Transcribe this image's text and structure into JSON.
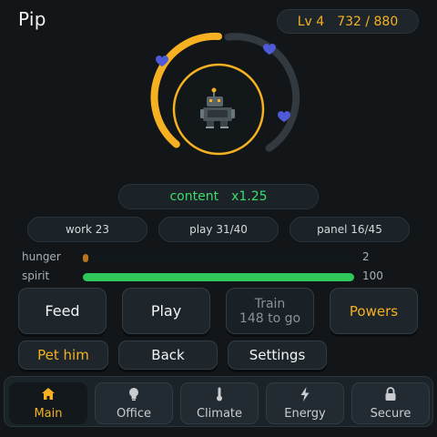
{
  "header": {
    "pet_name": "Pip",
    "level": "Lv 4",
    "xp": "732 / 880"
  },
  "pet": {
    "hearts": 3,
    "ring_progress": 0.5
  },
  "mood": {
    "label": "content",
    "multiplier": "x1.25"
  },
  "stats": [
    {
      "label": "work 23"
    },
    {
      "label": "play 31/40"
    },
    {
      "label": "panel 16/45"
    }
  ],
  "meters": [
    {
      "label": "hunger",
      "value": "2",
      "fraction": 0.02,
      "color": "#b8731b"
    },
    {
      "label": "spirit",
      "value": "100",
      "fraction": 1.0,
      "color": "#2ec95a"
    }
  ],
  "actions": {
    "feed": "Feed",
    "play": "Play",
    "train_title": "Train",
    "train_sub": "148 to go",
    "powers": "Powers",
    "pet_him": "Pet him",
    "back": "Back",
    "settings": "Settings"
  },
  "tabs": [
    {
      "label": "Main",
      "icon": "home-icon",
      "active": true
    },
    {
      "label": "Office",
      "icon": "lightbulb-icon",
      "active": false
    },
    {
      "label": "Climate",
      "icon": "thermometer-icon",
      "active": false
    },
    {
      "label": "Energy",
      "icon": "lightning-icon",
      "active": false
    },
    {
      "label": "Secure",
      "icon": "lock-icon",
      "active": false
    }
  ],
  "colors": {
    "accent": "#f5b121",
    "mood_green": "#3ddc6a",
    "heart": "#4f5ad8",
    "background": "#121619"
  }
}
